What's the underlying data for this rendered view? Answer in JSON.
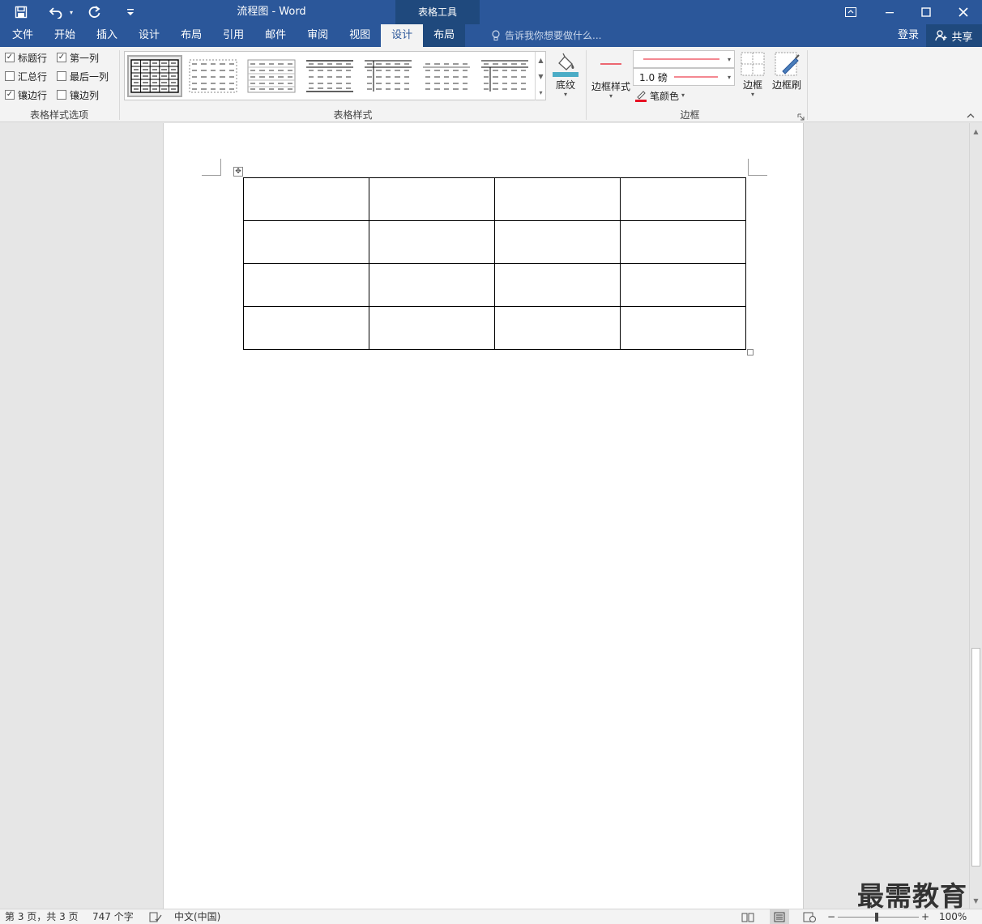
{
  "title_bar": {
    "doc_title": "流程图 - Word",
    "context_tab_group": "表格工具",
    "icons": [
      "save-icon",
      "undo-icon",
      "redo-icon",
      "customize-qat-icon",
      "ribbon-display-icon",
      "minimize-icon",
      "maximize-icon",
      "close-icon"
    ]
  },
  "tabs": [
    {
      "label": "文件"
    },
    {
      "label": "开始"
    },
    {
      "label": "插入"
    },
    {
      "label": "设计"
    },
    {
      "label": "布局"
    },
    {
      "label": "引用"
    },
    {
      "label": "邮件"
    },
    {
      "label": "审阅"
    },
    {
      "label": "视图"
    },
    {
      "label": "设计",
      "active": true,
      "contextual": true
    },
    {
      "label": "布局",
      "contextual": true
    }
  ],
  "tell_me": {
    "placeholder": "告诉我你想要做什么..."
  },
  "account": {
    "login": "登录",
    "share": "共享"
  },
  "ribbon": {
    "table_style_options": {
      "group_label": "表格样式选项",
      "options": [
        {
          "label": "标题行",
          "checked": true
        },
        {
          "label": "第一列",
          "checked": true
        },
        {
          "label": "汇总行",
          "checked": false
        },
        {
          "label": "最后一列",
          "checked": false
        },
        {
          "label": "镶边行",
          "checked": true
        },
        {
          "label": "镶边列",
          "checked": false
        }
      ]
    },
    "table_styles": {
      "group_label": "表格样式",
      "gallery_count": 7,
      "shading_label": "底纹",
      "shading_color": "#4bacc6"
    },
    "borders": {
      "group_label": "边框",
      "border_styles_label": "边框样式",
      "pen_weight": "1.0 磅",
      "pen_color_label": "笔颜色",
      "pen_color": "#e81123",
      "borders_label": "边框",
      "border_painter_label": "边框刷"
    }
  },
  "document": {
    "table": {
      "rows": 4,
      "cols": 4
    }
  },
  "status_bar": {
    "page_info": "第 3 页，共 3 页",
    "word_count": "747 个字",
    "language": "中文(中国)",
    "zoom": "100%"
  },
  "watermark": "最需教育",
  "colors": {
    "accent": "#2b579a",
    "context": "#1f497d"
  }
}
